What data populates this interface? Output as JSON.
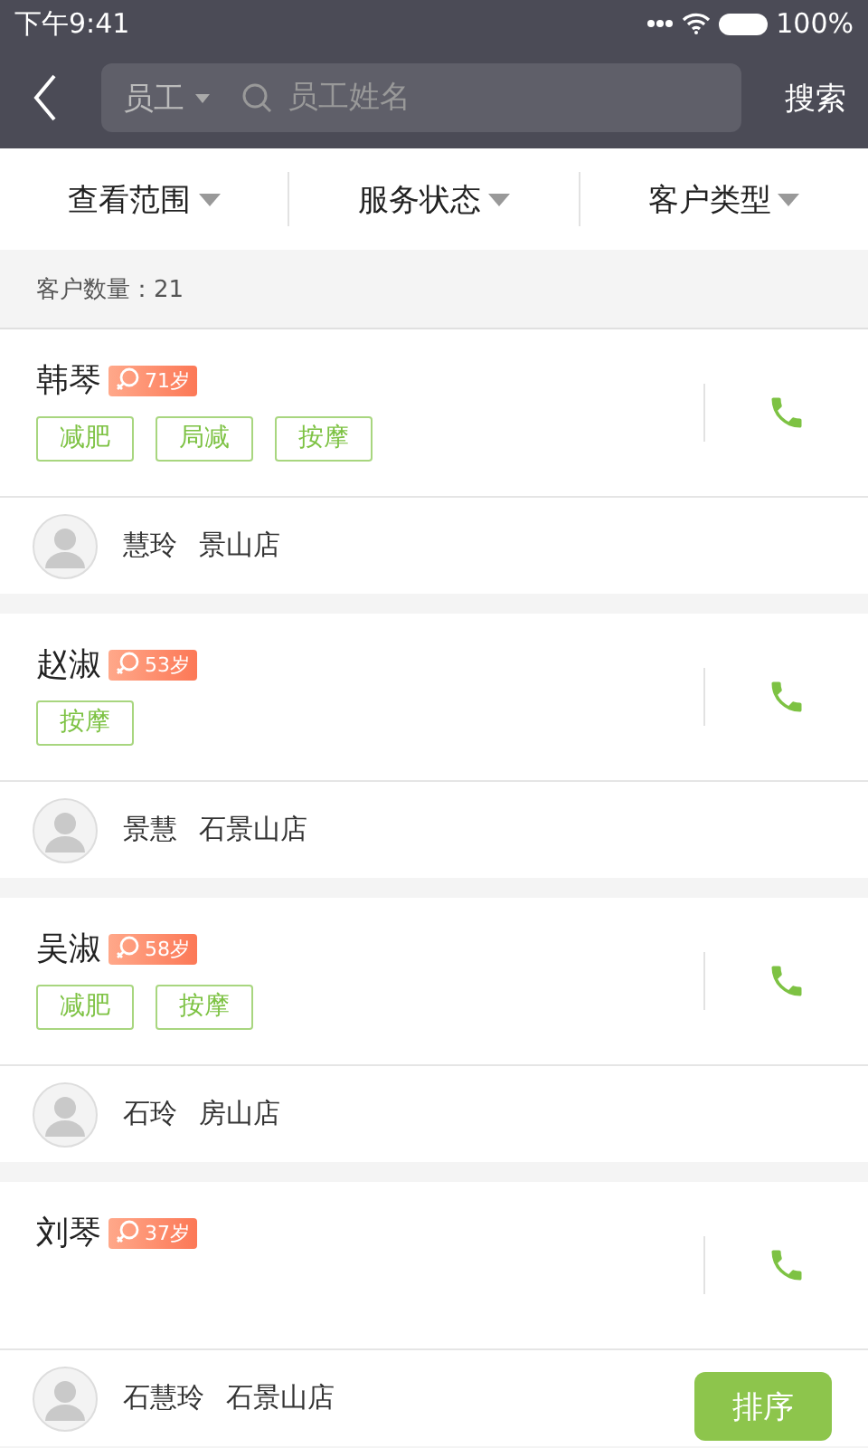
{
  "status_bar": {
    "time": "下午9:41",
    "battery": "100%"
  },
  "nav": {
    "scope": "员工",
    "placeholder": "员工姓名",
    "search": "搜索"
  },
  "filters": [
    {
      "label": "查看范围"
    },
    {
      "label": "服务状态"
    },
    {
      "label": "客户类型"
    }
  ],
  "count": {
    "label": "客户数量：",
    "value": "21"
  },
  "customers": [
    {
      "name": "韩琴",
      "age": "71岁",
      "tags": [
        "减肥",
        "局减",
        "按摩"
      ],
      "staff": "慧玲",
      "store": "景山店"
    },
    {
      "name": "赵淑",
      "age": "53岁",
      "tags": [
        "按摩"
      ],
      "staff": "景慧",
      "store": "石景山店"
    },
    {
      "name": "吴淑",
      "age": "58岁",
      "tags": [
        "减肥",
        "按摩"
      ],
      "staff": "石玲",
      "store": "房山店"
    },
    {
      "name": "刘琴",
      "age": "37岁",
      "staff": "石慧玲",
      "store": "石景山店"
    }
  ],
  "sort_button": "排序"
}
